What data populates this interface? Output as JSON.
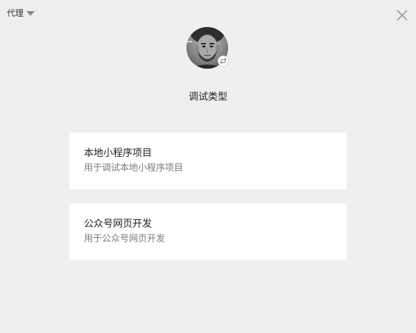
{
  "header": {
    "proxy_label": "代理",
    "proxy_icon": "triangle-down-icon",
    "close_icon": "close-icon"
  },
  "profile": {
    "avatar_icon": "user-avatar",
    "switch_icon": "switch-arrows-icon",
    "switch_glyph": "⇄"
  },
  "page": {
    "title": "调试类型"
  },
  "options": [
    {
      "title": "本地小程序项目",
      "description": "用于调试本地小程序项目"
    },
    {
      "title": "公众号网页开发",
      "description": "用于公众号网页开发"
    }
  ],
  "colors": {
    "background": "#efefef",
    "card": "#ffffff",
    "title_text": "#222222",
    "description_text": "#7a7a7a"
  }
}
